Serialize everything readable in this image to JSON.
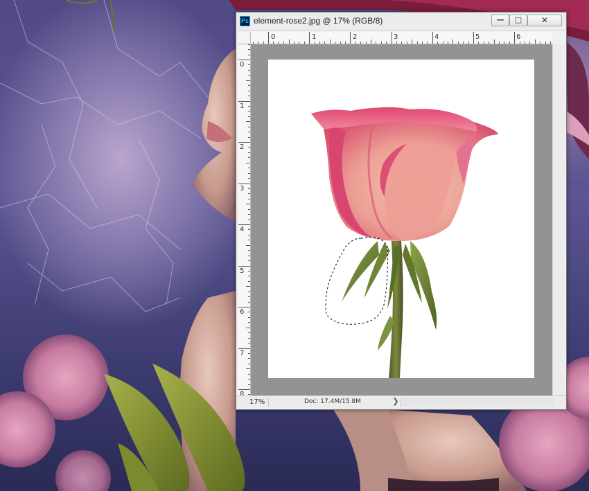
{
  "window": {
    "app_icon": "Ps",
    "title": "element-rose2.jpg @ 17% (RGB/8)",
    "minimize_symbol": "—",
    "maximize_symbol": "□",
    "close_symbol": "✕"
  },
  "rulers": {
    "horizontal": [
      "0",
      "1",
      "2",
      "3",
      "4",
      "5",
      "6"
    ],
    "vertical": [
      "0",
      "1",
      "2",
      "3",
      "4",
      "5",
      "6",
      "7",
      "8"
    ]
  },
  "status_bar": {
    "zoom": "17%",
    "doc_size": "Doc: 17.4M/15.8M",
    "menu_arrow": "❯"
  },
  "colors": {
    "ps_brand": "#31a8ff",
    "canvas_backdrop": "#939393",
    "document_background": "#ffffff",
    "rose_petal": "#e2476f"
  },
  "icons": {
    "app": "photoshop-icon",
    "minimize": "minimize-icon",
    "maximize": "maximize-icon",
    "close": "close-icon"
  }
}
